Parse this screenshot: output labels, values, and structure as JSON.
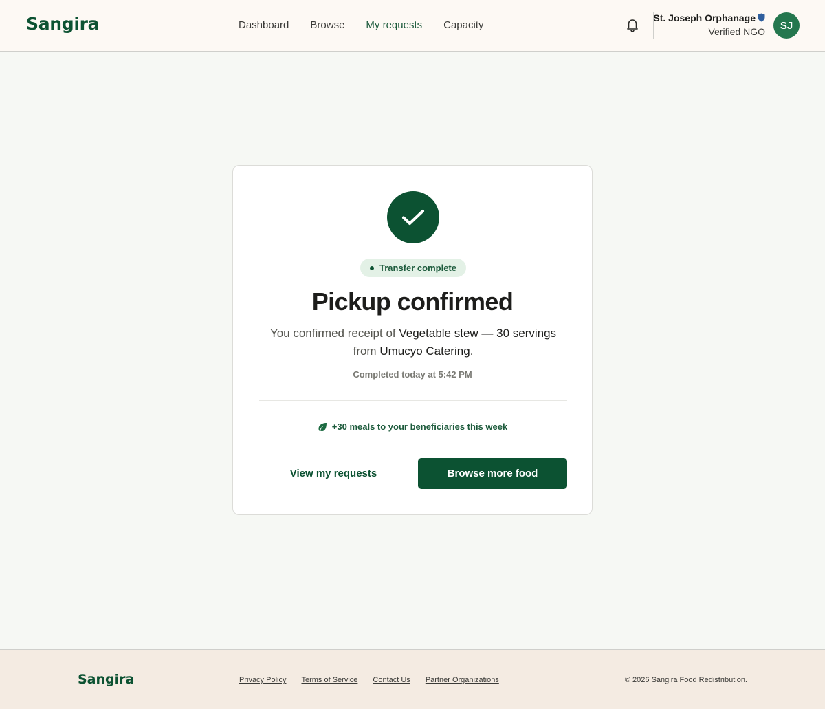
{
  "header": {
    "logo": "Sangira",
    "nav": [
      {
        "label": "Dashboard"
      },
      {
        "label": "Browse"
      },
      {
        "label": "My requests"
      },
      {
        "label": "Capacity"
      }
    ],
    "active_nav": "My requests",
    "user": {
      "name": "St. Joseph Orphanage",
      "role": "Verified NGO",
      "initials": "SJ",
      "verified_icon": "shield-icon"
    },
    "notification_icon": "bell-icon"
  },
  "card": {
    "icon": "checkmark-icon",
    "status": "Transfer complete",
    "title": "Pickup confirmed",
    "desc_prefix": "You confirmed receipt of ",
    "item": "Vegetable stew — 30 servings",
    "desc_mid": " from ",
    "donor": "Umucyo Catering",
    "desc_suffix": ".",
    "completed": "Completed today at 5:42 PM",
    "impact": "+30 meals to your beneficiaries this week",
    "impact_icon": "leaf-icon",
    "secondary_button": "View my requests",
    "primary_button": "Browse more food"
  },
  "footer": {
    "logo": "Sangira",
    "links": [
      {
        "label": "Privacy Policy"
      },
      {
        "label": "Terms of Service"
      },
      {
        "label": "Contact Us"
      },
      {
        "label": "Partner Organizations"
      }
    ],
    "copyright": "© 2026 Sangira Food Redistribution."
  },
  "colors": {
    "brand": "#0c5232",
    "avatar": "#24774e",
    "pill_bg": "#e3f1e6",
    "header_bg": "#fdf9f4",
    "footer_bg": "#f4ebe2",
    "page_bg": "#f6f8f4"
  }
}
